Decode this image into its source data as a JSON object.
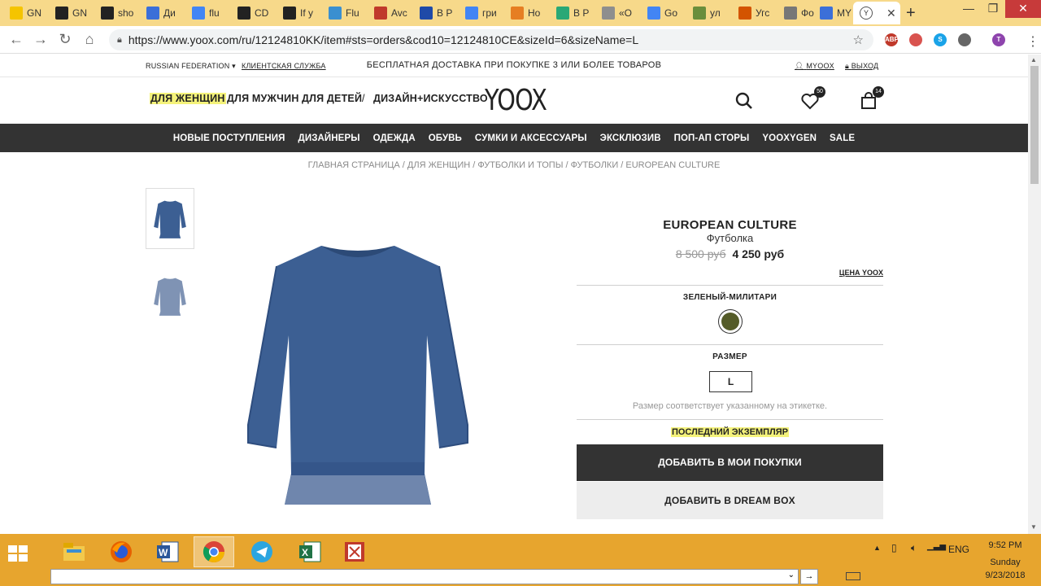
{
  "browser": {
    "tabs": [
      {
        "label": "GN",
        "color": "#f5c400"
      },
      {
        "label": "GN",
        "color": "#222222"
      },
      {
        "label": "sho",
        "color": "#222222"
      },
      {
        "label": "Ди",
        "color": "#3b6fd8"
      },
      {
        "label": "flu",
        "color": "#4285f4"
      },
      {
        "label": "CD",
        "color": "#222222"
      },
      {
        "label": "If y",
        "color": "#222222"
      },
      {
        "label": "Flu",
        "color": "#3a8fd0"
      },
      {
        "label": "Avc",
        "color": "#c0392b"
      },
      {
        "label": "В Р",
        "color": "#1f4aa8"
      },
      {
        "label": "гри",
        "color": "#4285f4"
      },
      {
        "label": "Но",
        "color": "#e67e22"
      },
      {
        "label": "В Р",
        "color": "#2aa876"
      },
      {
        "label": "«О",
        "color": "#8e8e8e"
      },
      {
        "label": "Go",
        "color": "#4285f4"
      },
      {
        "label": "ул",
        "color": "#6a8e3c"
      },
      {
        "label": "Угс",
        "color": "#d35400"
      },
      {
        "label": "Фо",
        "color": "#777777"
      },
      {
        "label": "MY",
        "color": "#3b6fd8"
      }
    ],
    "active_tab_label": "Y",
    "url": "https://www.yoox.com/ru/12124810KK/item#sts=orders&cod10=12124810CE&sizeId=6&sizeName=L",
    "extensions": [
      {
        "label": "ABP",
        "color": "#c0392b"
      },
      {
        "label": "",
        "color": "#d9534f"
      },
      {
        "label": "S",
        "color": "#1aa3e8"
      },
      {
        "label": "",
        "color": "#666666"
      },
      {
        "label": "T",
        "color": "#8e44ad"
      }
    ]
  },
  "site": {
    "region": "RUSSIAN FEDERATION",
    "customer_service": "КЛИЕНТСКАЯ СЛУЖБА",
    "promo": "БЕСПЛАТНАЯ ДОСТАВКА ПРИ ПОКУПКЕ 3 ИЛИ БОЛЕЕ ТОВАРОВ",
    "myoox": "MYOOX",
    "logout": "ВЫХОД",
    "gender_nav": [
      {
        "label": "ДЛЯ ЖЕНЩИН"
      },
      {
        "label": "ДЛЯ МУЖЧИН"
      },
      {
        "label": "ДЛЯ ДЕТЕЙ"
      },
      {
        "label": "/"
      },
      {
        "label": "ДИЗАЙН+ИСКУССТВО"
      }
    ],
    "logo": "YOOX",
    "wishlist_count": "50",
    "cart_count": "14",
    "main_nav": [
      "НОВЫЕ ПОСТУПЛЕНИЯ",
      "ДИЗАЙНЕРЫ",
      "ОДЕЖДА",
      "ОБУВЬ",
      "СУМКИ И АКСЕССУАРЫ",
      "ЭКСКЛЮЗИВ",
      "ПОП-АП СТОРЫ",
      "YOOXYGEN",
      "SALE"
    ],
    "breadcrumbs": "ГЛАВНАЯ СТРАНИЦА / ДЛЯ ЖЕНЩИН / ФУТБОЛКИ И ТОПЫ / ФУТБОЛКИ / EUROPEAN CULTURE"
  },
  "product": {
    "brand": "EUROPEAN CULTURE",
    "type": "Футболка",
    "old_price": "8 500 руб",
    "new_price": "4 250 руб",
    "yoox_price_link": "ЦЕНА YOOX",
    "color_label": "ЗЕЛЕНЫЙ-МИЛИТАРИ",
    "swatch_color": "#545b28",
    "garment_color": "#3c5f93",
    "size_label": "РАЗМЕР",
    "size_selected": "L",
    "size_note": "Размер соответствует указанному на этикетке.",
    "last_item": "ПОСЛЕДНИЙ ЭКЗЕМПЛЯР",
    "add_to_cart": "ДОБАВИТЬ В МОИ ПОКУПКИ",
    "add_to_dreambox": "ДОБАВИТЬ В DREAM BOX"
  },
  "taskbar": {
    "lang": "ENG",
    "time": "9:52 PM",
    "day": "Sunday",
    "date": "9/23/2018"
  }
}
